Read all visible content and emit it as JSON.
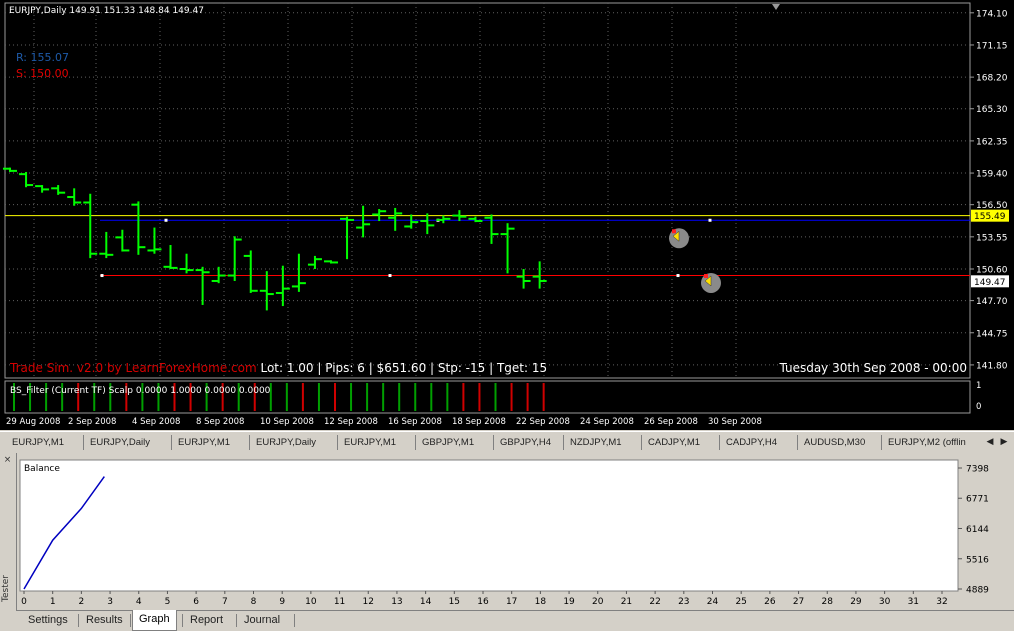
{
  "chart": {
    "symbol_header": "EURJPY,Daily  149.91 151.33 148.84 149.47",
    "sim_r": "R: 155.07",
    "sim_s": "S: 150.00",
    "info_brand": "Trade Sim. v2.0 by LearnForexHome.com",
    "info_stats": " Lot: 1.00 | Pips: 6 | $651.60 | Stp: -15 | Tget: 15",
    "info_date": "Tuesday 30th Sep 2008 - 00:00",
    "indicator_label": "BS_Filter (Current TF) Scalp 0.0000 1.0000 0.0000 0.0000",
    "price_labels": [
      "174.10",
      "171.15",
      "168.20",
      "165.30",
      "162.35",
      "159.40",
      "156.50",
      "153.55",
      "150.60",
      "147.70",
      "144.75",
      "141.80"
    ],
    "current_price_tag": "149.47",
    "ma_price_tag": "155.49",
    "indicator_axis": [
      "1",
      "0"
    ],
    "date_labels": [
      "29 Aug 2008",
      "2 Sep 2008",
      "4 Sep 2008",
      "8 Sep 2008",
      "10 Sep 2008",
      "12 Sep 2008",
      "16 Sep 2008",
      "18 Sep 2008",
      "22 Sep 2008",
      "24 Sep 2008",
      "26 Sep 2008",
      "30 Sep 2008"
    ],
    "candles": [
      {
        "o": 159.8,
        "h": 159.9,
        "l": 159.5,
        "c": 159.6
      },
      {
        "o": 159.3,
        "h": 159.5,
        "l": 158.1,
        "c": 158.3
      },
      {
        "o": 158.2,
        "h": 158.3,
        "l": 157.6,
        "c": 157.9
      },
      {
        "o": 158.0,
        "h": 158.3,
        "l": 157.4,
        "c": 157.6
      },
      {
        "o": 157.2,
        "h": 158.0,
        "l": 156.4,
        "c": 156.7
      },
      {
        "o": 156.7,
        "h": 157.5,
        "l": 151.6,
        "c": 152.0
      },
      {
        "o": 152.0,
        "h": 154.0,
        "l": 151.6,
        "c": 151.9
      },
      {
        "o": 153.5,
        "h": 154.2,
        "l": 152.2,
        "c": 152.3
      },
      {
        "o": 156.5,
        "h": 156.8,
        "l": 151.9,
        "c": 152.6
      },
      {
        "o": 152.3,
        "h": 154.4,
        "l": 152.0,
        "c": 152.4
      },
      {
        "o": 150.8,
        "h": 152.8,
        "l": 150.6,
        "c": 150.7
      },
      {
        "o": 150.6,
        "h": 152.0,
        "l": 150.2,
        "c": 150.5
      },
      {
        "o": 150.5,
        "h": 150.8,
        "l": 147.3,
        "c": 150.3
      },
      {
        "o": 149.5,
        "h": 150.8,
        "l": 149.3,
        "c": 150.0
      },
      {
        "o": 150.0,
        "h": 153.6,
        "l": 149.5,
        "c": 153.3
      },
      {
        "o": 151.8,
        "h": 152.3,
        "l": 148.4,
        "c": 148.6
      },
      {
        "o": 148.6,
        "h": 150.4,
        "l": 146.8,
        "c": 148.3
      },
      {
        "o": 148.4,
        "h": 150.9,
        "l": 147.2,
        "c": 148.8
      },
      {
        "o": 149.0,
        "h": 152.0,
        "l": 148.5,
        "c": 149.3
      },
      {
        "o": 151.0,
        "h": 151.8,
        "l": 150.6,
        "c": 151.5
      },
      {
        "o": 151.3,
        "h": 151.4,
        "l": 151.1,
        "c": 151.2
      },
      {
        "o": 155.2,
        "h": 155.4,
        "l": 151.5,
        "c": 155.1
      },
      {
        "o": 154.4,
        "h": 156.4,
        "l": 153.5,
        "c": 154.7
      },
      {
        "o": 155.6,
        "h": 156.1,
        "l": 155.0,
        "c": 155.9
      },
      {
        "o": 155.3,
        "h": 156.2,
        "l": 154.1,
        "c": 155.7
      },
      {
        "o": 154.5,
        "h": 155.6,
        "l": 154.3,
        "c": 154.9
      },
      {
        "o": 155.0,
        "h": 155.7,
        "l": 153.8,
        "c": 154.6
      },
      {
        "o": 155.1,
        "h": 155.5,
        "l": 154.8,
        "c": 155.2
      },
      {
        "o": 155.5,
        "h": 156.0,
        "l": 155.0,
        "c": 155.4
      },
      {
        "o": 155.2,
        "h": 155.4,
        "l": 154.9,
        "c": 155.0
      },
      {
        "o": 155.3,
        "h": 155.6,
        "l": 152.9,
        "c": 153.8
      },
      {
        "o": 153.8,
        "h": 154.8,
        "l": 150.2,
        "c": 154.3
      },
      {
        "o": 149.9,
        "h": 150.6,
        "l": 148.8,
        "c": 149.5
      },
      {
        "o": 149.9,
        "h": 151.3,
        "l": 148.8,
        "c": 149.5
      }
    ],
    "indicator_bars": [
      1,
      1,
      1,
      1,
      0,
      1,
      1,
      0,
      1,
      1,
      0,
      0,
      1,
      0,
      1,
      0,
      1,
      1,
      0,
      1,
      0,
      1,
      1,
      1,
      1,
      1,
      1,
      1,
      0,
      0,
      1,
      0,
      0,
      0
    ],
    "colors": {
      "bull": "#00ff00",
      "bear": "#00ff00",
      "ma": "#ffff00",
      "resistance": "#0000ff",
      "support": "#ff0000",
      "grid": "#606060",
      "ind_up": "#00a000",
      "ind_down": "#d00000"
    }
  },
  "chart_tabs": [
    "EURJPY,M1",
    "EURJPY,Daily",
    "EURJPY,M1",
    "EURJPY,Daily",
    "EURJPY,M1",
    "GBPJPY,M1",
    "GBPJPY,H4",
    "NZDJPY,M1",
    "CADJPY,M1",
    "CADJPY,H4",
    "AUDUSD,M30",
    "EURJPY,M2 (offlin"
  ],
  "tester": {
    "side_label": "Tester",
    "close_icon": "×",
    "balance_label": "Balance",
    "y_labels": [
      "7398",
      "6771",
      "6144",
      "5516",
      "4889"
    ],
    "x_labels": [
      "0",
      "1",
      "2",
      "3",
      "4",
      "5",
      "6",
      "7",
      "8",
      "9",
      "10",
      "11",
      "12",
      "13",
      "14",
      "15",
      "16",
      "17",
      "18",
      "19",
      "20",
      "21",
      "22",
      "23",
      "24",
      "25",
      "26",
      "27",
      "28",
      "29",
      "30",
      "31",
      "32"
    ],
    "tabs": [
      "Settings",
      "Results",
      "Graph",
      "Report",
      "Journal"
    ],
    "active_tab": "Graph"
  },
  "chart_data": {
    "type": "line",
    "title": "",
    "series": [
      {
        "name": "Balance",
        "x": [
          0,
          1,
          2,
          2.8
        ],
        "y": [
          4889,
          5900,
          6560,
          7220
        ]
      }
    ],
    "xlim": [
      0,
      32
    ],
    "ylim": [
      4889,
      7398
    ]
  }
}
